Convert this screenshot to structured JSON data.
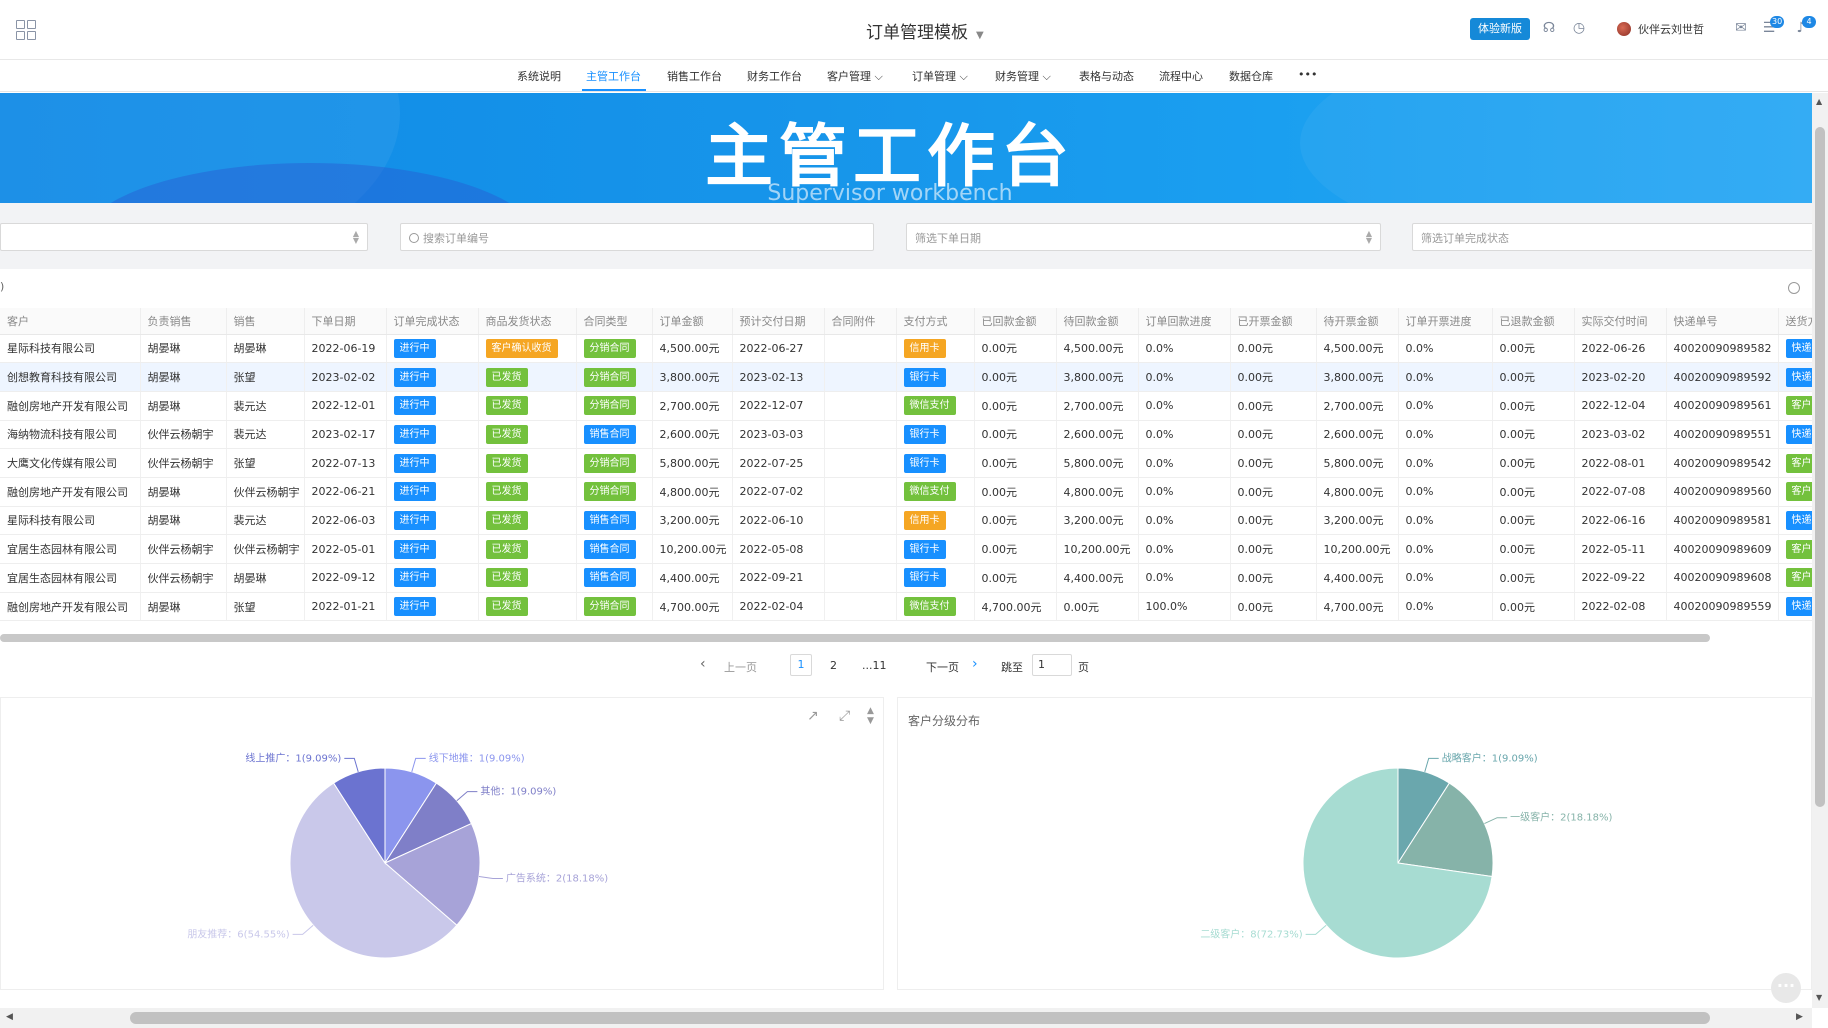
{
  "header": {
    "app_title": "订单管理模板",
    "trial_label": "体验新版",
    "username": "伙伴云刘世哲",
    "badge_count_1": "30",
    "badge_count_2": "4"
  },
  "nav": {
    "items": [
      "系统说明",
      "主管工作台",
      "销售工作台",
      "财务工作台",
      "客户管理",
      "订单管理",
      "财务管理",
      "表格与动态",
      "流程中心",
      "数据仓库",
      "•••"
    ],
    "active": "主管工作台"
  },
  "banner": {
    "title": "主管工作台",
    "subtitle": "Supervisor workbench"
  },
  "filters": {
    "search_order_placeholder": "搜索订单编号",
    "date_placeholder": "筛选下单日期",
    "status_placeholder": "筛选订单完成状态"
  },
  "table": {
    "paren": ")",
    "columns": [
      "客户",
      "负责销售",
      "销售",
      "下单日期",
      "订单完成状态",
      "商品发货状态",
      "合同类型",
      "订单金额",
      "预计交付日期",
      "合同附件",
      "支付方式",
      "已回款金额",
      "待回款金额",
      "订单回款进度",
      "已开票金额",
      "待开票金额",
      "订单开票进度",
      "已退款金额",
      "实际交付时间",
      "快递单号",
      "送货方"
    ],
    "rows": [
      [
        "星际科技有限公司",
        "胡晏琳",
        "胡晏琳",
        "2022-06-19",
        "进行中",
        "客户确认收货",
        "分销合同",
        "4,500.00元",
        "2022-06-27",
        "",
        "信用卡",
        "0.00元",
        "4,500.00元",
        "0.0%",
        "0.00元",
        "4,500.00元",
        "0.0%",
        "0.00元",
        "2022-06-26",
        "40020090989582",
        "快递"
      ],
      [
        "创想教育科技有限公司",
        "胡晏琳",
        "张望",
        "2023-02-02",
        "进行中",
        "已发货",
        "分销合同",
        "3,800.00元",
        "2023-02-13",
        "",
        "银行卡",
        "0.00元",
        "3,800.00元",
        "0.0%",
        "0.00元",
        "3,800.00元",
        "0.0%",
        "0.00元",
        "2023-02-20",
        "40020090989592",
        "快递"
      ],
      [
        "融创房地产开发有限公司",
        "胡晏琳",
        "裴元达",
        "2022-12-01",
        "进行中",
        "已发货",
        "分销合同",
        "2,700.00元",
        "2022-12-07",
        "",
        "微信支付",
        "0.00元",
        "2,700.00元",
        "0.0%",
        "0.00元",
        "2,700.00元",
        "0.0%",
        "0.00元",
        "2022-12-04",
        "40020090989561",
        "客户"
      ],
      [
        "海纳物流科技有限公司",
        "伙伴云杨朝宇",
        "裴元达",
        "2023-02-17",
        "进行中",
        "已发货",
        "销售合同",
        "2,600.00元",
        "2023-03-03",
        "",
        "银行卡",
        "0.00元",
        "2,600.00元",
        "0.0%",
        "0.00元",
        "2,600.00元",
        "0.0%",
        "0.00元",
        "2023-03-02",
        "40020090989551",
        "快递"
      ],
      [
        "大鹰文化传媒有限公司",
        "伙伴云杨朝宇",
        "张望",
        "2022-07-13",
        "进行中",
        "已发货",
        "分销合同",
        "5,800.00元",
        "2022-07-25",
        "",
        "银行卡",
        "0.00元",
        "5,800.00元",
        "0.0%",
        "0.00元",
        "5,800.00元",
        "0.0%",
        "0.00元",
        "2022-08-01",
        "40020090989542",
        "客户"
      ],
      [
        "融创房地产开发有限公司",
        "胡晏琳",
        "伙伴云杨朝宇",
        "2022-06-21",
        "进行中",
        "已发货",
        "分销合同",
        "4,800.00元",
        "2022-07-02",
        "",
        "微信支付",
        "0.00元",
        "4,800.00元",
        "0.0%",
        "0.00元",
        "4,800.00元",
        "0.0%",
        "0.00元",
        "2022-07-08",
        "40020090989560",
        "客户"
      ],
      [
        "星际科技有限公司",
        "胡晏琳",
        "裴元达",
        "2022-06-03",
        "进行中",
        "已发货",
        "销售合同",
        "3,200.00元",
        "2022-06-10",
        "",
        "信用卡",
        "0.00元",
        "3,200.00元",
        "0.0%",
        "0.00元",
        "3,200.00元",
        "0.0%",
        "0.00元",
        "2022-06-16",
        "40020090989581",
        "快递"
      ],
      [
        "宜居生态园林有限公司",
        "伙伴云杨朝宇",
        "伙伴云杨朝宇",
        "2022-05-01",
        "进行中",
        "已发货",
        "销售合同",
        "10,200.00元",
        "2022-05-08",
        "",
        "银行卡",
        "0.00元",
        "10,200.00元",
        "0.0%",
        "0.00元",
        "10,200.00元",
        "0.0%",
        "0.00元",
        "2022-05-11",
        "40020090989609",
        "客户"
      ],
      [
        "宜居生态园林有限公司",
        "伙伴云杨朝宇",
        "胡晏琳",
        "2022-09-12",
        "进行中",
        "已发货",
        "销售合同",
        "4,400.00元",
        "2022-09-21",
        "",
        "银行卡",
        "0.00元",
        "4,400.00元",
        "0.0%",
        "0.00元",
        "4,400.00元",
        "0.0%",
        "0.00元",
        "2022-09-22",
        "40020090989608",
        "客户"
      ],
      [
        "融创房地产开发有限公司",
        "胡晏琳",
        "张望",
        "2022-01-21",
        "进行中",
        "已发货",
        "分销合同",
        "4,700.00元",
        "2022-02-04",
        "",
        "微信支付",
        "4,700.00元",
        "0.00元",
        "100.0%",
        "0.00元",
        "4,700.00元",
        "0.0%",
        "0.00元",
        "2022-02-08",
        "40020090989559",
        "快递"
      ]
    ],
    "tag_colors": {
      "进行中": "blue",
      "客户确认收货": "orange",
      "已发货": "green",
      "分销合同": "green",
      "销售合同": "blue",
      "信用卡": "orange",
      "银行卡": "blue",
      "微信支付": "green",
      "快递": "blue",
      "客户": "green"
    }
  },
  "pager": {
    "prev": "上一页",
    "next": "下一页",
    "current": "1",
    "page2": "2",
    "last": "...11",
    "jump_label": "跳至",
    "jump_value": "1",
    "page_unit": "页"
  },
  "chart_data": [
    {
      "type": "pie",
      "title": "",
      "labels": [
        "线下地推",
        "其他",
        "广告系统",
        "朋友推荐",
        "线上推广"
      ],
      "values": [
        1,
        1,
        2,
        6,
        1
      ],
      "display": [
        "线下地推：1(9.09%)",
        "其他：1(9.09%)",
        "广告系统：2(18.18%)",
        "朋友推荐：6(54.55%)",
        "线上推广：1(9.09%)"
      ],
      "colors": [
        "#8b95ee",
        "#7f7fc8",
        "#a7a3d8",
        "#c9c8ea",
        "#6b73d0"
      ]
    },
    {
      "type": "pie",
      "title": "客户分级分布",
      "labels": [
        "战略客户",
        "一级客户",
        "二级客户"
      ],
      "values": [
        1,
        2,
        8
      ],
      "display": [
        "战略客户：1(9.09%)",
        "一级客户：2(18.18%)",
        "二级客户：8(72.73%)"
      ],
      "colors": [
        "#6aa7ad",
        "#86b3a9",
        "#a7dcd2"
      ]
    }
  ]
}
